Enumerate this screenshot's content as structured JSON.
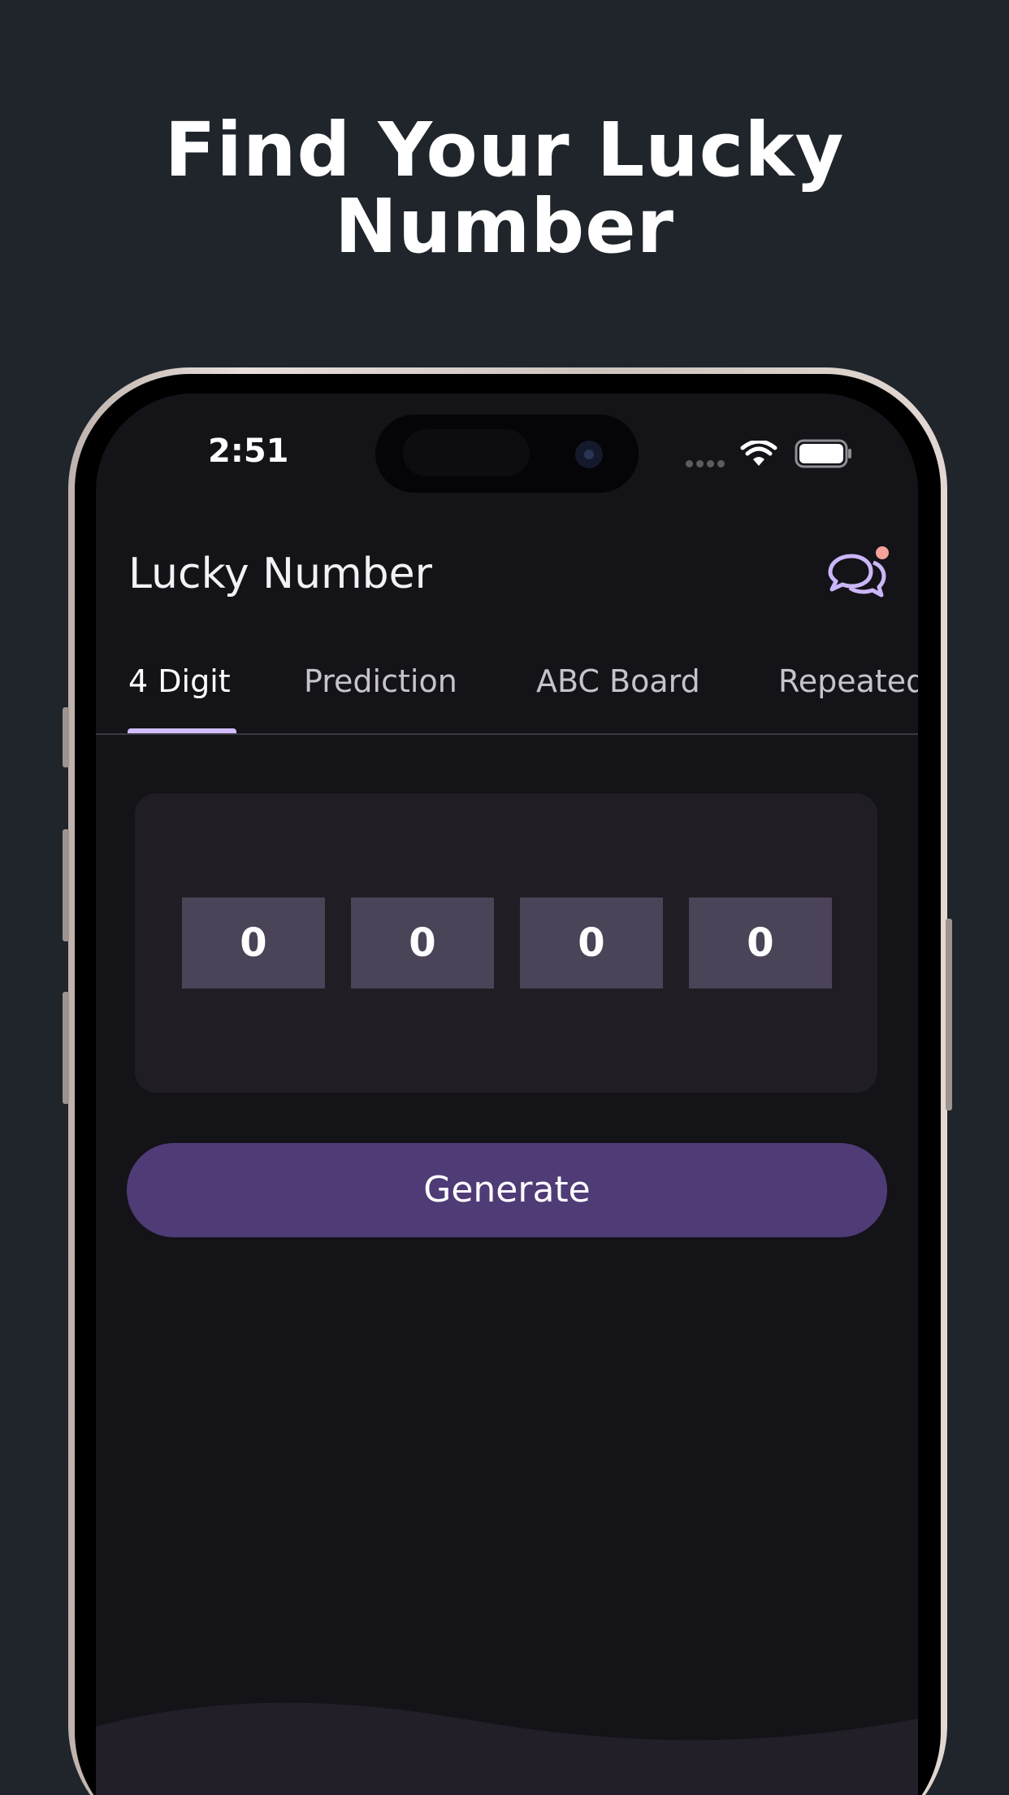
{
  "headline": {
    "line1": "Find Your Lucky",
    "line2": "Number"
  },
  "status_bar": {
    "time": "2:51",
    "icons": [
      "signal-dots-icon",
      "wifi-icon",
      "battery-icon"
    ]
  },
  "app_bar": {
    "title": "Lucky Number",
    "chat_icon": "chat-bubbles-icon",
    "notification_dot": true
  },
  "tabs": [
    {
      "label": "4 Digit",
      "active": true
    },
    {
      "label": "Prediction",
      "active": false
    },
    {
      "label": "ABC Board",
      "active": false
    },
    {
      "label": "Repeated",
      "active": false
    }
  ],
  "digits": [
    "0",
    "0",
    "0",
    "0"
  ],
  "generate_button": {
    "label": "Generate"
  },
  "colors": {
    "page_background": "#20252c",
    "screen_background": "#141318",
    "card_background": "#211d24",
    "digit_box": "#4b4357",
    "accent": "#d1bcfd",
    "button": "#4f3b76",
    "notification": "#f4a29a"
  }
}
